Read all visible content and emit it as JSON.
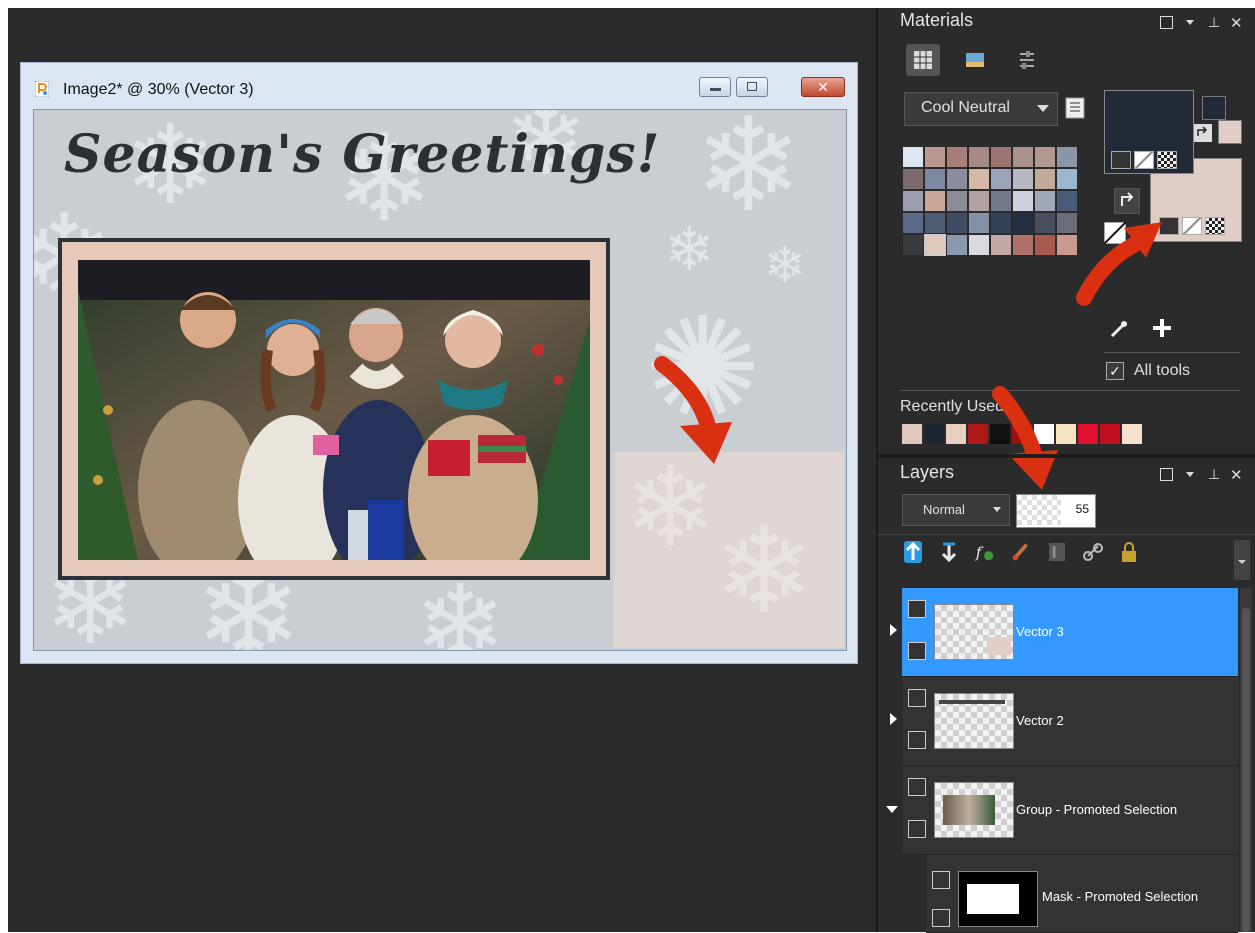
{
  "document": {
    "title": "Image2* @  30% (Vector 3)",
    "close_glyph": "✕",
    "headline": "Season's Greetings!"
  },
  "materials": {
    "title": "Materials",
    "palette_name": "Cool Neutral",
    "all_tools_label": "All tools",
    "all_tools_checked": "✓",
    "recently_used_label": "Recently Used",
    "swatches": [
      "#dbe6f2",
      "#b89890",
      "#a87e78",
      "#a58a86",
      "#9c7472",
      "#a9928e",
      "#b3988f",
      "#8a97a8",
      "#7d6a6a",
      "#7b8aa0",
      "#8b8ca0",
      "#d6b8a6",
      "#9aa4b8",
      "#b7b8c2",
      "#c2a99a",
      "#9ab7cf",
      "#9c9fb0",
      "#c9a898",
      "#8a8c97",
      "#b2a0a2",
      "#707a8c",
      "#cfd0dc",
      "#a0a8b8",
      "#4a5a78",
      "#5a6a88",
      "#4e5c74",
      "#3e4c64",
      "#8492a8",
      "#324058",
      "#252f44",
      "#4a4e5e",
      "#6a6c7a",
      "#3a3a40",
      "#e0c8bc",
      "#8a98b0",
      "#dcd8e0",
      "#c4a8a8",
      "#b0706a",
      "#a85a50",
      "#c89a90"
    ],
    "recent": [
      "#e2c8bc",
      "#1e2430",
      "#e8cfc2",
      "#b01818",
      "#111111",
      "#a01010",
      "#ffffff",
      "#f5e3c2",
      "#e01030",
      "#c01020",
      "#f7e1cf"
    ],
    "fg_color": "#222a37",
    "bg_color": "#dfcdc6"
  },
  "layers": {
    "title": "Layers",
    "blend_mode": "Normal",
    "opacity": "55",
    "items": [
      {
        "name": "Vector 3"
      },
      {
        "name": "Vector 2"
      },
      {
        "name": "Group - Promoted Selection"
      },
      {
        "name": "Mask - Promoted Selection"
      }
    ]
  }
}
